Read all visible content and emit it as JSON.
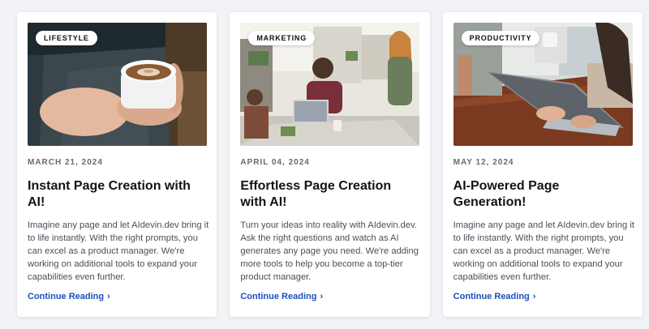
{
  "posts": [
    {
      "category": "LIFESTYLE",
      "date": "MARCH 21, 2024",
      "title": "Instant Page Creation with AI!",
      "excerpt": "Imagine any page and let AIdevin.dev bring it to life instantly. With the right prompts, you can excel as a product manager. We're working on additional tools to expand your capabilities even further.",
      "cta": "Continue Reading",
      "image_icon": "coffee-cup-photo"
    },
    {
      "category": "MARKETING",
      "date": "APRIL 04, 2024",
      "title": "Effortless Page Creation with AI!",
      "excerpt": "Turn your ideas into reality with AIdevin.dev. Ask the right questions and watch as AI generates any page you need. We're adding more tools to help you become a top-tier product manager.",
      "cta": "Continue Reading",
      "image_icon": "office-meeting-photo"
    },
    {
      "category": "PRODUCTIVITY",
      "date": "MAY 12, 2024",
      "title": "AI-Powered Page Generation!",
      "excerpt": "Imagine any page and let AIdevin.dev bring it to life instantly. With the right prompts, you can excel as a product manager. We're working on additional tools to expand your capabilities even further.",
      "cta": "Continue Reading",
      "image_icon": "laptop-typing-photo"
    }
  ],
  "colors": {
    "link": "#1d4fbf",
    "background": "#f1f3f6"
  }
}
